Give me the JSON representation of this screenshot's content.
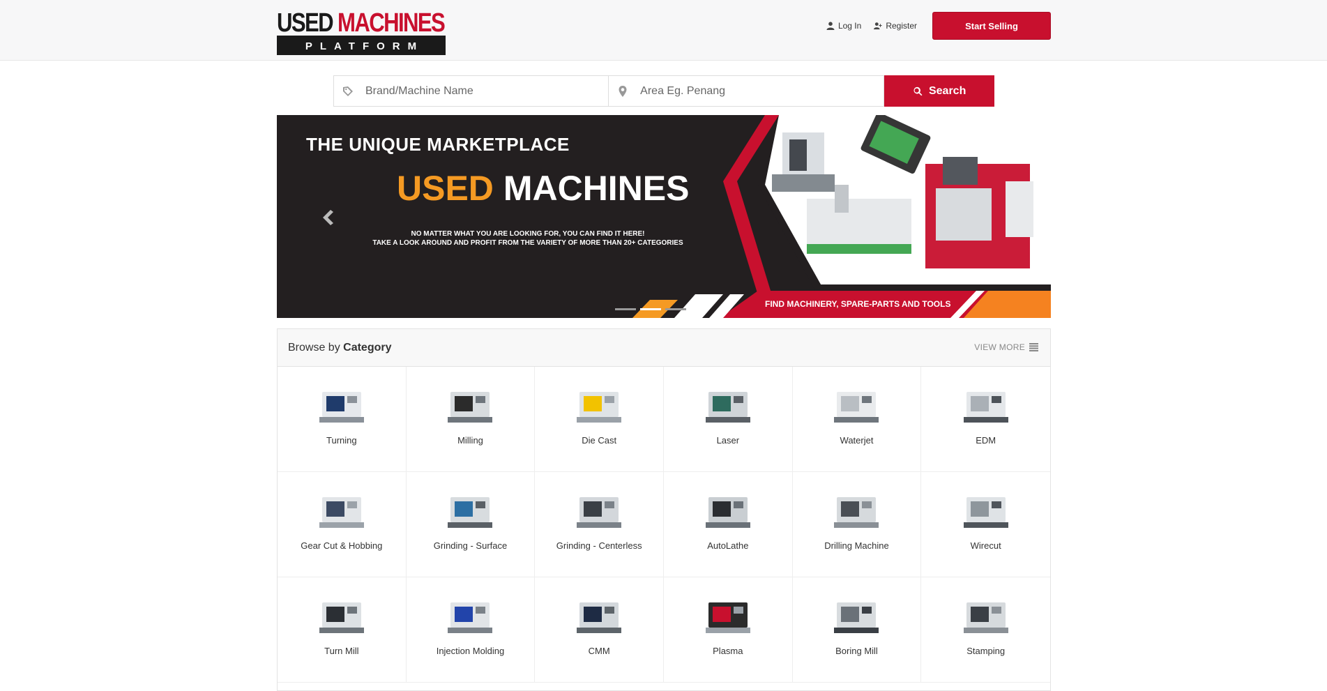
{
  "brand": {
    "logo_line1_a": "USED",
    "logo_line1_b": "MACHINES",
    "logo_line2": "PLATFORM"
  },
  "nav": {
    "login": "Log In",
    "register": "Register",
    "start_selling": "Start Selling"
  },
  "search": {
    "brand_placeholder": "Brand/Machine Name",
    "area_placeholder": "Area Eg. Penang",
    "button": "Search"
  },
  "banner": {
    "title": "THE  UNIQUE MARKETPLACE",
    "big_a": "USED",
    "big_b": "MACHINES",
    "sub_line1": "NO MATTER WHAT YOU ARE LOOKING FOR, YOU CAN FIND IT HERE!",
    "sub_line2": "TAKE A LOOK AROUND AND PROFIT FROM THE VARIETY OF MORE THAN 20+ CATEGORIES",
    "footer": "FIND MACHINERY, SPARE-PARTS AND TOOLS",
    "slides": 3,
    "active_slide": 2,
    "colors": {
      "red": "#c8102e",
      "orange": "#f59a23",
      "dark": "#231f20"
    }
  },
  "categories": {
    "heading_prefix": "Browse by ",
    "heading_bold": "Category",
    "view_more": "VIEW MORE",
    "items": [
      {
        "label": "Turning",
        "icon": "turning-machine-icon"
      },
      {
        "label": "Milling",
        "icon": "milling-machine-icon"
      },
      {
        "label": "Die Cast",
        "icon": "die-cast-machine-icon"
      },
      {
        "label": "Laser",
        "icon": "laser-machine-icon"
      },
      {
        "label": "Waterjet",
        "icon": "waterjet-machine-icon"
      },
      {
        "label": "EDM",
        "icon": "edm-machine-icon"
      },
      {
        "label": "Gear Cut & Hobbing",
        "icon": "gear-cut-machine-icon"
      },
      {
        "label": "Grinding - Surface",
        "icon": "surface-grinder-icon"
      },
      {
        "label": "Grinding - Centerless",
        "icon": "centerless-grinder-icon"
      },
      {
        "label": "AutoLathe",
        "icon": "autolathe-machine-icon"
      },
      {
        "label": "Drilling Machine",
        "icon": "drilling-machine-icon"
      },
      {
        "label": "Wirecut",
        "icon": "wirecut-machine-icon"
      },
      {
        "label": "Turn Mill",
        "icon": "turn-mill-machine-icon"
      },
      {
        "label": "Injection Molding",
        "icon": "injection-molding-icon"
      },
      {
        "label": "CMM",
        "icon": "cmm-machine-icon"
      },
      {
        "label": "Plasma",
        "icon": "plasma-machine-icon"
      },
      {
        "label": "Boring Mill",
        "icon": "boring-mill-icon"
      },
      {
        "label": "Stamping",
        "icon": "stamping-machine-icon"
      }
    ]
  }
}
